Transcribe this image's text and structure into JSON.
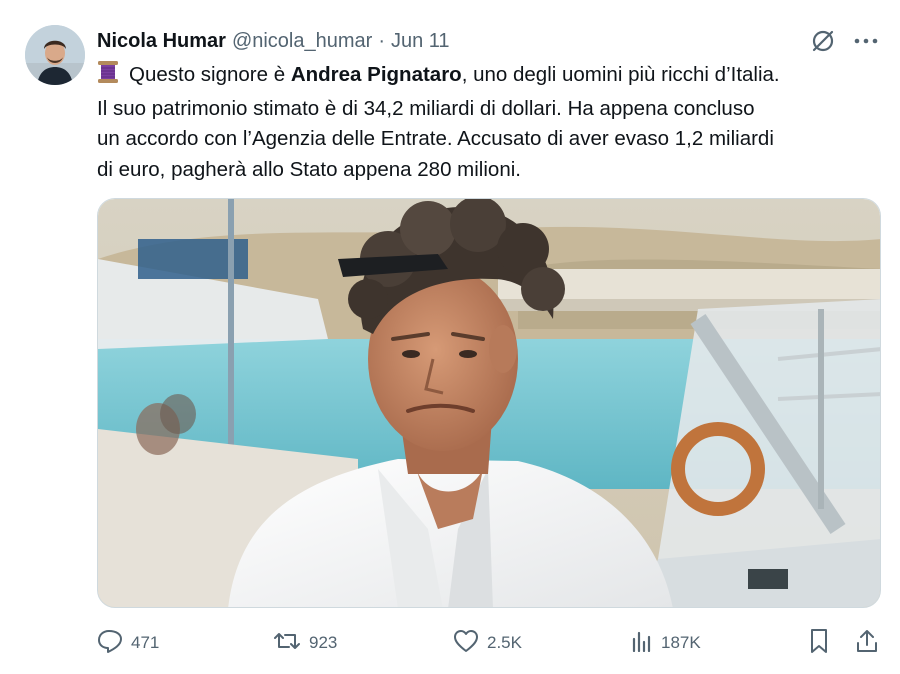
{
  "author": {
    "display_name": "Nicola Humar",
    "handle": "@nicola_humar",
    "separator": "·",
    "date": "Jun 11"
  },
  "tweet": {
    "line1_pre": "Questo signore è ",
    "line1_bold": "Andrea Pignataro",
    "line1_post": ", uno degli uomini più ricchi d’Italia.",
    "line2": "Il suo patrimonio stimato è di 34,2 miliardi di dollari. Ha appena concluso",
    "line3": "un accordo con l’Agenzia delle Entrate. Accusato di aver evaso 1,2 miliardi",
    "line4": "di euro, pagherà allo Stato appena 280 milioni.",
    "thread_icon": "thread-spool-icon"
  },
  "metrics": {
    "replies": "471",
    "reposts": "923",
    "likes": "2.5K",
    "views": "187K"
  },
  "icons": {
    "grok": "grok-icon",
    "more": "more-icon",
    "reply": "reply-icon",
    "repost": "repost-icon",
    "like": "heart-icon",
    "views": "views-icon",
    "bookmark": "bookmark-icon",
    "share": "share-icon"
  },
  "colors": {
    "text_primary": "#0f1419",
    "text_secondary": "#536471",
    "thread_purple": "#7b3fa0",
    "sea": "#7ecbd6"
  }
}
